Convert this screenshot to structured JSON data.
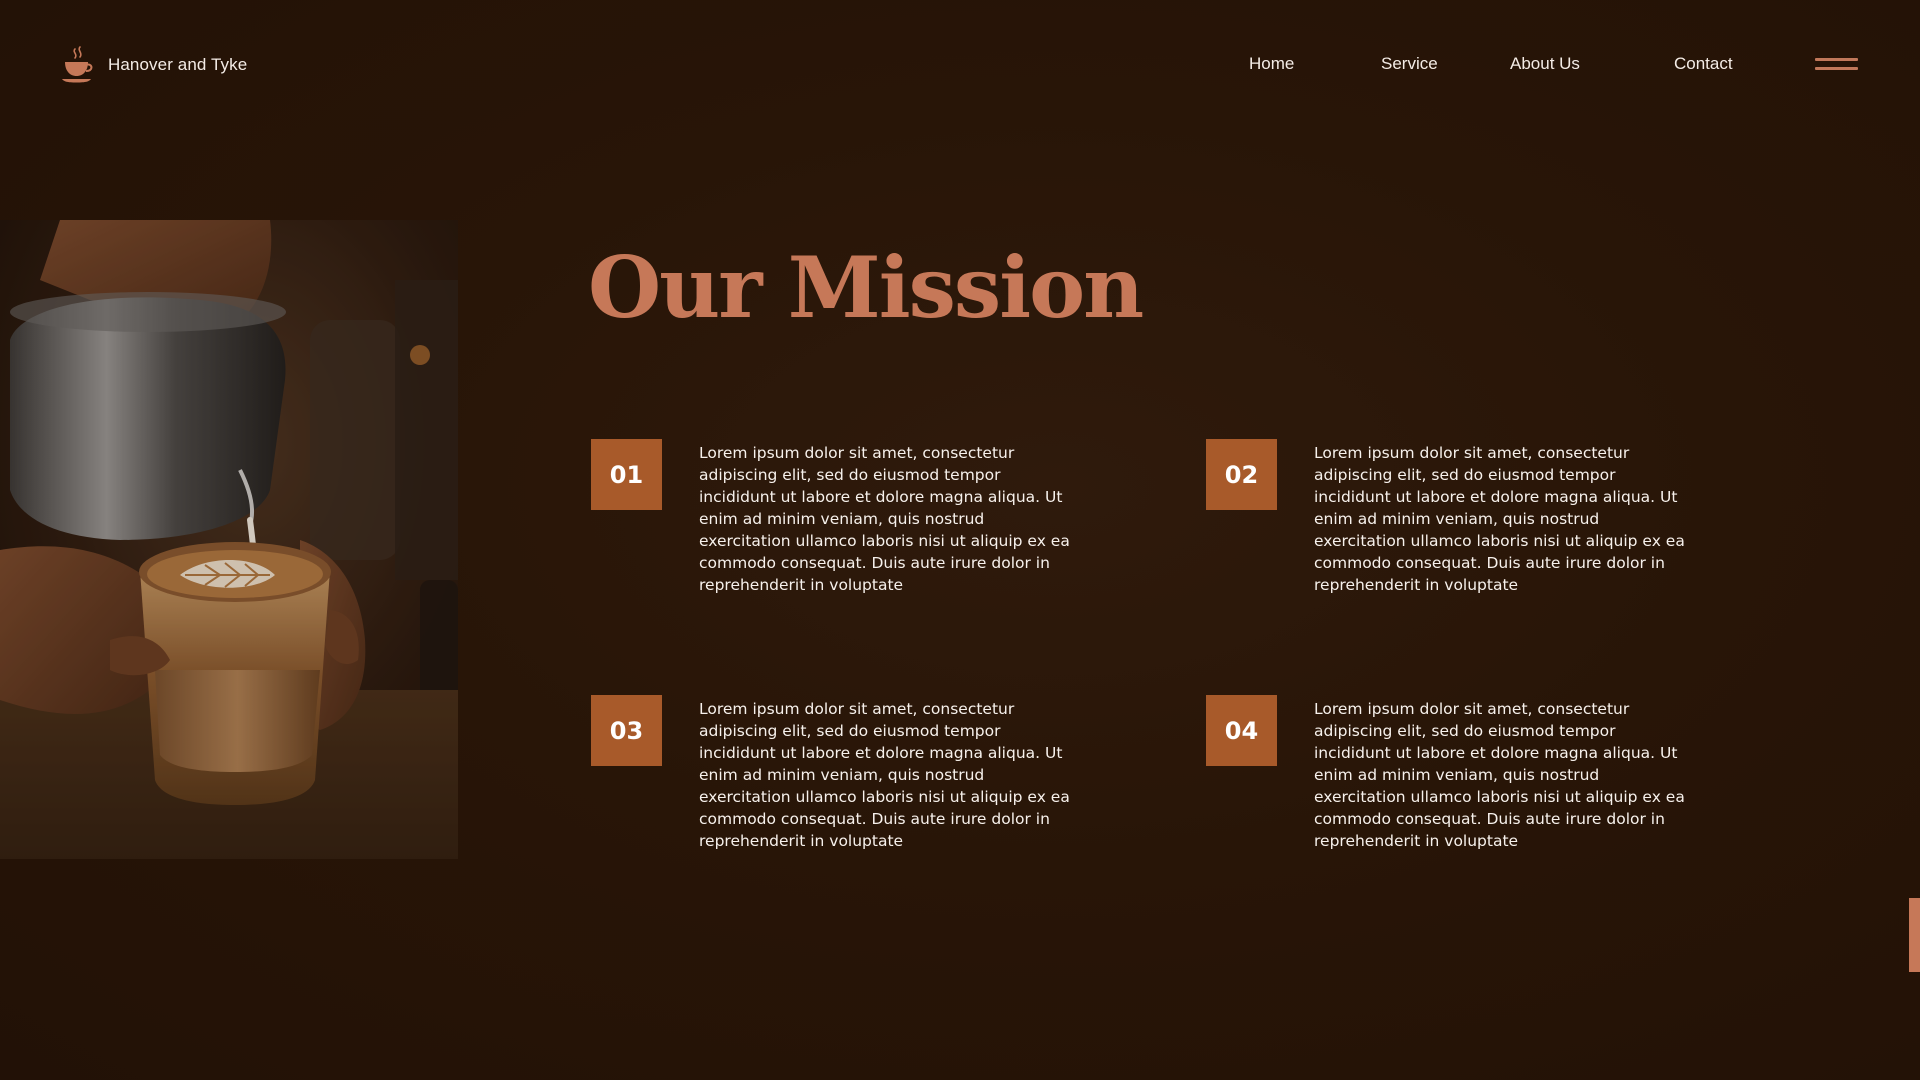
{
  "brand": {
    "name": "Hanover and Tyke",
    "logo_icon": "coffee-cup-icon"
  },
  "nav": {
    "items": [
      {
        "label": "Home"
      },
      {
        "label": "Service"
      },
      {
        "label": "About Us"
      },
      {
        "label": "Contact"
      }
    ],
    "menu_icon": "hamburger-menu-icon"
  },
  "hero": {
    "image": "latte-art-pour-photo"
  },
  "section": {
    "title": "Our Mission",
    "items": [
      {
        "number": "01",
        "text": "Lorem ipsum dolor sit amet, consectetur adipiscing elit, sed do eiusmod tempor incididunt ut labore et dolore magna aliqua. Ut enim ad minim veniam, quis nostrud exercitation ullamco laboris nisi ut aliquip ex ea commodo consequat. Duis aute irure dolor in reprehenderit in voluptate"
      },
      {
        "number": "02",
        "text": "Lorem ipsum dolor sit amet, consectetur adipiscing elit, sed do eiusmod tempor incididunt ut labore et dolore magna aliqua. Ut enim ad minim veniam, quis nostrud exercitation ullamco laboris nisi ut aliquip ex ea commodo consequat. Duis aute irure dolor in reprehenderit in voluptate"
      },
      {
        "number": "03",
        "text": "Lorem ipsum dolor sit amet, consectetur adipiscing elit, sed do eiusmod tempor incididunt ut labore et dolore magna aliqua. Ut enim ad minim veniam, quis nostrud exercitation ullamco laboris nisi ut aliquip ex ea commodo consequat. Duis aute irure dolor in reprehenderit in voluptate"
      },
      {
        "number": "04",
        "text": "Lorem ipsum dolor sit amet, consectetur adipiscing elit, sed do eiusmod tempor incididunt ut labore et dolore magna aliqua. Ut enim ad minim veniam, quis nostrud exercitation ullamco laboris nisi ut aliquip ex ea commodo consequat. Duis aute irure dolor in reprehenderit in voluptate"
      }
    ]
  },
  "colors": {
    "background": "#281507",
    "accent": "#c67858",
    "number_box": "#a85a2a",
    "text": "#f7f1ec"
  }
}
